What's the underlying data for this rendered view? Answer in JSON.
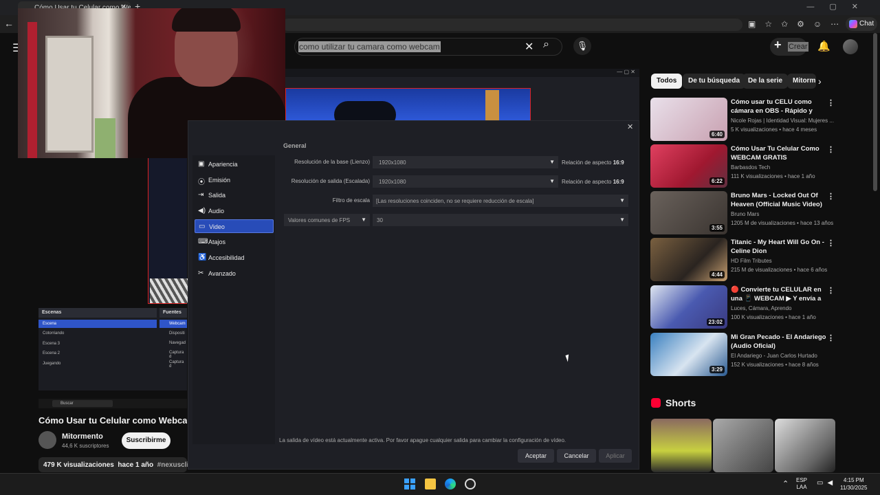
{
  "browser": {
    "tab_title": "Cómo Usar tu Celular como Webca",
    "chat_label": "Chat"
  },
  "youtube": {
    "search_query": "como utilizar tu camara como webcam",
    "create_label": "Crear"
  },
  "obs": {
    "scenes_header": "Escenas",
    "sources_header": "Fuentes",
    "scenes": [
      "Escena",
      "Cotorriando",
      "Escena 3",
      "Escena 2",
      "Juegando"
    ],
    "sources": [
      "Webcam",
      "Dispositi",
      "Navegad",
      "Captura d",
      "Captura d"
    ],
    "mini_search": "Buscar"
  },
  "settings": {
    "section": "General",
    "nav": [
      "Apariencia",
      "Emisión",
      "Salida",
      "Audio",
      "Video",
      "Atajos",
      "Accesibilidad",
      "Avanzado"
    ],
    "selected_nav": "Video",
    "base_label": "Resolución de la base (Lienzo)",
    "base_value": "1920x1080",
    "output_label": "Resolución de salida (Escalada)",
    "output_value": "1920x1080",
    "aspect_prefix": "Relación de aspecto",
    "aspect_value": "16:9",
    "filter_label": "Filtro de escala",
    "filter_value": "[Las resoluciones coinciden, no se requiere reducción de escala]",
    "fps_label": "Valores comunes de FPS",
    "fps_value": "30",
    "warning": "La salida de vídeo está actualmente activa. Por favor apague cualquier salida para cambiar la configuración de vídeo.",
    "accept": "Aceptar",
    "cancel": "Cancelar",
    "apply": "Aplicar"
  },
  "video": {
    "title": "Cómo Usar tu Celular como Webcam",
    "channel": "Mitormento",
    "subs": "44,6 K suscriptores",
    "subscribe": "Suscribirme",
    "views": "479 K visualizaciones",
    "age": "hace 1 año",
    "tag": "#nexusclips"
  },
  "chips": [
    "Todos",
    "De tu búsqueda",
    "De la serie",
    "Mitorm"
  ],
  "related": [
    {
      "title": "Cómo usar tu CELU como cámara en OBS - Rápido y Fácil",
      "channel": "Nicole Rojas | Identidad Visual: Mujeres ...",
      "stats": "5 K visualizaciones • hace 4 meses",
      "duration": "6:40",
      "color": "#e6dbe6"
    },
    {
      "title": "Cómo Usar Tu Celular Como WEBCAM GRATIS",
      "channel": "Barbasdos Tech",
      "stats": "111 K visualizaciones • hace 1 año",
      "duration": "6:22",
      "color": "#c83050"
    },
    {
      "title": "Bruno Mars - Locked Out Of Heaven (Official Music Video)",
      "channel": "Bruno Mars",
      "stats": "1205 M de visualizaciones • hace 13 años",
      "duration": "3:55",
      "color": "#5a5450"
    },
    {
      "title": "Titanic - My Heart Will Go On - Celine Dion",
      "channel": "HD Film Tributes",
      "stats": "215 M de visualizaciones • hace 6 años",
      "duration": "4:44",
      "color": "#5a4a3a"
    },
    {
      "title": "🔴 Convierte tu CELULAR en una 📱 WEBCAM ▶ Y envía a ...",
      "channel": "Luces, Cámara, Aprendo",
      "stats": "100 K visualizaciones • hace 1 año",
      "duration": "23:02",
      "color": "#3a4aa0"
    },
    {
      "title": "Mi Gran Pecado - El Andariego (Audio Oficial)",
      "channel": "El Andariego - Juan Carlos Hurtado",
      "stats": "152 K visualizaciones • hace 8 años",
      "duration": "3:29",
      "color": "#2a6aa8"
    }
  ],
  "shorts_title": "Shorts",
  "taskbar": {
    "lang1": "ESP",
    "lang2": "LAA",
    "time": "4:15 PM",
    "date": "11/30/2025"
  }
}
